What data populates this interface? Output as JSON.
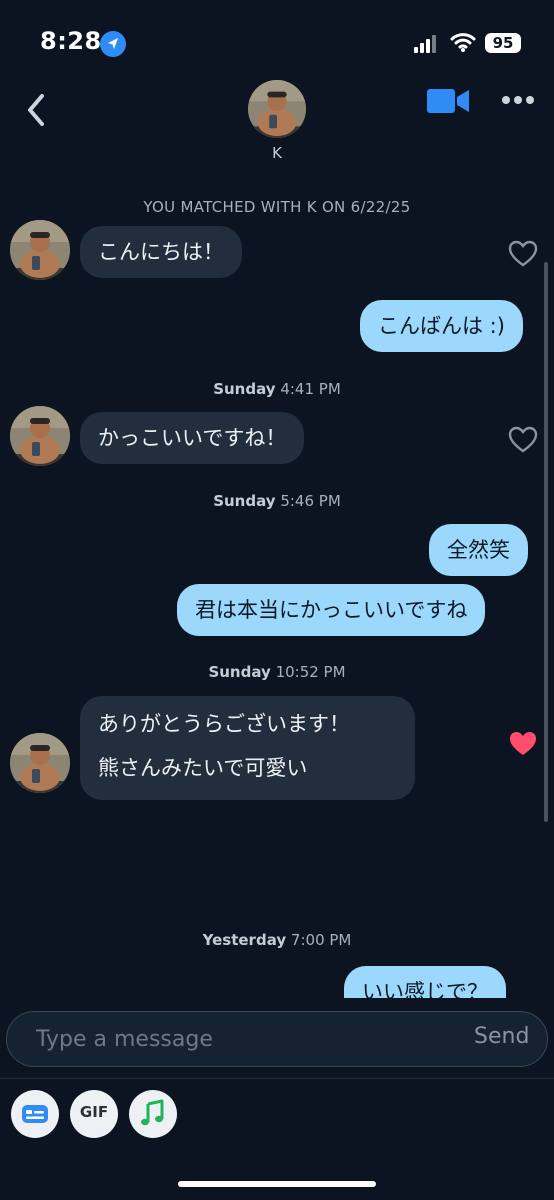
{
  "status_bar": {
    "time": "8:28",
    "battery": "95"
  },
  "header": {
    "name": "K"
  },
  "chat": {
    "match_line": "YOU MATCHED WITH K ON 6/22/25",
    "messages": [
      {
        "dir": "in",
        "text": "こんにちは！",
        "liked": false
      },
      {
        "dir": "out",
        "text": "こんばんは :)"
      },
      {
        "dir": "in",
        "text": "かっこいいですね！",
        "liked": false
      },
      {
        "dir": "out",
        "text": "全然笑"
      },
      {
        "dir": "out",
        "text": "君は本当にかっこいいですね"
      },
      {
        "dir": "in",
        "lines": [
          "ありがとうらございます！",
          "熊さんみたいで可愛い"
        ],
        "liked": true
      },
      {
        "dir": "out",
        "text": "いい感じで？"
      }
    ],
    "timestamps": [
      {
        "day": "Sunday",
        "time": "4:41 PM"
      },
      {
        "day": "Sunday",
        "time": "5:46 PM"
      },
      {
        "day": "Sunday",
        "time": "10:52 PM"
      },
      {
        "day": "Yesterday",
        "time": "7:00 PM"
      }
    ]
  },
  "composer": {
    "placeholder": "Type a message",
    "send_label": "Send"
  },
  "toolbar": {
    "gif_label": "GIF"
  },
  "colors": {
    "background": "#0b1420",
    "incoming_bubble": "#222d3d",
    "outgoing_bubble": "#9cd8fb",
    "accent_blue": "#2f8cf7",
    "heart_liked": "#ff4d6d"
  },
  "icons": [
    "location-arrow-icon",
    "signal-icon",
    "wifi-icon",
    "battery-icon",
    "back-chevron-icon",
    "video-call-icon",
    "more-icon",
    "heart-icon",
    "card-icon",
    "music-note-icon"
  ]
}
